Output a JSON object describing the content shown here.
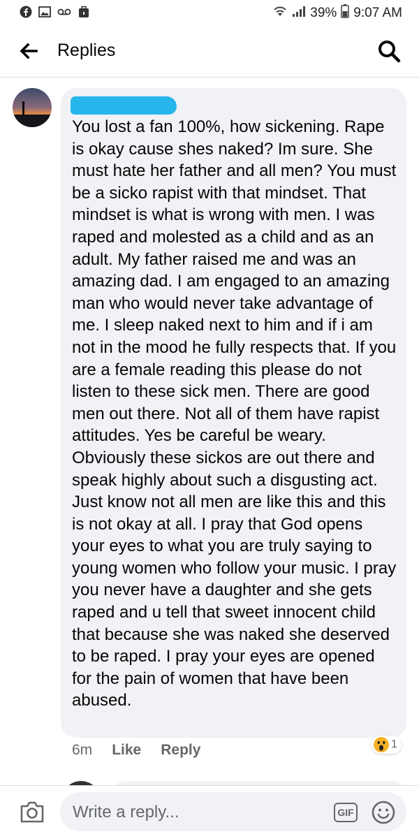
{
  "status_bar": {
    "left_icons": [
      "facebook-icon",
      "gallery-icon",
      "voicemail-icon",
      "briefcase-icon"
    ],
    "wifi_icon": "wifi-icon",
    "signal_icon": "signal-icon",
    "battery_percent": "39%",
    "battery_icon": "battery-icon",
    "time": "9:07 AM"
  },
  "app_bar": {
    "back_icon": "arrow-left-icon",
    "title": "Replies",
    "search_icon": "search-icon"
  },
  "comment": {
    "text": "You lost a fan 100%, how sickening. Rape is okay cause shes naked? Im sure. She must hate her father and all men? You must be a sicko rapist with that mindset. That mindset is what is wrong with men. I was raped and molested as a child and as an adult. My father raised me and was an amazing dad. I am engaged to an amazing man who would never take advantage of me. I sleep naked next to him and if i am not in the mood he fully respects that. If you are a female reading this please do not listen to these sick men. There are good men out there. Not all of them have rapist attitudes. Yes be careful be weary. Obviously these sickos are out there and speak highly about such a disgusting act. Just know not all men are like this and this is not okay at all. I pray that God opens your eyes to what you are truly saying to young women who follow your music. I pray you never have a daughter and she gets raped and u tell that sweet innocent child that because she was naked she deserved to be raped. I pray your eyes are opened for the pain of women that have been abused.",
    "time": "6m",
    "like_label": "Like",
    "reply_label": "Reply",
    "reaction_icon": "wow-reaction-icon",
    "reaction_count": "1"
  },
  "reply_bar": {
    "camera_icon": "camera-icon",
    "placeholder": "Write a reply...",
    "gif_label": "GIF",
    "emoji_icon": "smiley-icon"
  },
  "colors": {
    "bubble": "#f0f2f5",
    "secondary_text": "#65676b",
    "redaction": "#27b6ec",
    "reaction_yellow": "#f7b125"
  }
}
